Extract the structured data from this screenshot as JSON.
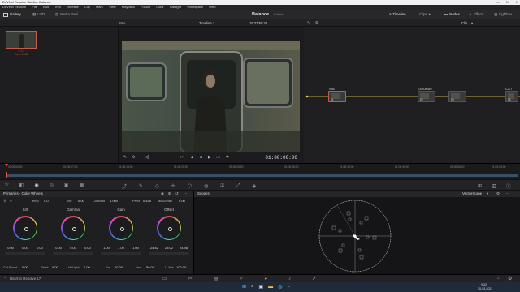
{
  "window": {
    "title": "DaVinci Resolve Studio - Balance",
    "min": "—",
    "max": "☐",
    "close": "✕"
  },
  "menu": [
    "DaVinci Resolve",
    "File",
    "Edit",
    "Trim",
    "Timeline",
    "Clip",
    "Mark",
    "View",
    "Playback",
    "Fusion",
    "Color",
    "Fairlight",
    "Workspace",
    "Help"
  ],
  "toolbar": {
    "gallery": "Gallery",
    "luts": "LUTs",
    "media_pool": "Media Pool",
    "project_title": "Balance",
    "edited": "Edited",
    "timeline": "Timeline",
    "clips": "Clips",
    "nodes": "Nodes",
    "effects": "Effects",
    "lightbox": "Lightbox"
  },
  "subheader": {
    "zoom": "68%",
    "timeline_name": "Timeline 1",
    "timecode": "15:27:50:20",
    "clip_label": "Clip"
  },
  "gallery": {
    "thumb_label1": "1.1.1",
    "thumb_label2": "Gain 1MB"
  },
  "viewer": {
    "timecode": "01:00:00:00"
  },
  "nodes": {
    "items": [
      {
        "label": "WB",
        "num": "01"
      },
      {
        "label": "Exposure",
        "num": "02"
      },
      {
        "label": "",
        "num": "03"
      },
      {
        "label": "CST",
        "num": "04"
      }
    ]
  },
  "ruler": {
    "ticks": [
      "01:00:00:00",
      "01:00:07:00",
      "01:00:14:00",
      "01:00:21:00",
      "01:00:28:00",
      "01:00:35:00",
      "01:00:42:00",
      "01:00:49:00",
      "01:00:56:00",
      "01:01:03:00"
    ]
  },
  "wheels_panel": {
    "title": "Primaries - Color Wheels",
    "temp_label": "Temp",
    "temp": "0.0",
    "tint_label": "Tint",
    "tint": "0.00",
    "contrast_label": "Contrast",
    "contrast": "1.000",
    "pivot_label": "Pivot",
    "pivot": "0.435",
    "middetail_label": "Mid/Detail",
    "middetail": "0.00",
    "wheels": [
      {
        "name": "Lift",
        "v1": "0.00",
        "v2": "0.00",
        "v3": "0.00"
      },
      {
        "name": "Gamma",
        "v1": "0.00",
        "v2": "0.00",
        "v3": "0.00"
      },
      {
        "name": "Gain",
        "v1": "1.00",
        "v2": "1.00",
        "v3": "1.00"
      },
      {
        "name": "Offset",
        "v1": "24.82",
        "v2": "25.02",
        "v3": "24.98"
      }
    ],
    "colboost_label": "Col Boost",
    "colboost": "0.00",
    "shad_label": "Shad",
    "shad": "0.00",
    "hilight_label": "Hi/Light",
    "hilight": "0.00",
    "sat_label": "Sat",
    "sat": "50.00",
    "hue_label": "Hue",
    "hue": "50.00",
    "lmix_label": "L. Mix",
    "lmix": "100.00"
  },
  "scopes": {
    "title": "Scopes",
    "mode": "Vectorscope"
  },
  "resolve_bar": {
    "app_label": "DaVinci Resolve 17"
  },
  "taskbar": {
    "time": "9:32",
    "date": "10-03-2021"
  }
}
